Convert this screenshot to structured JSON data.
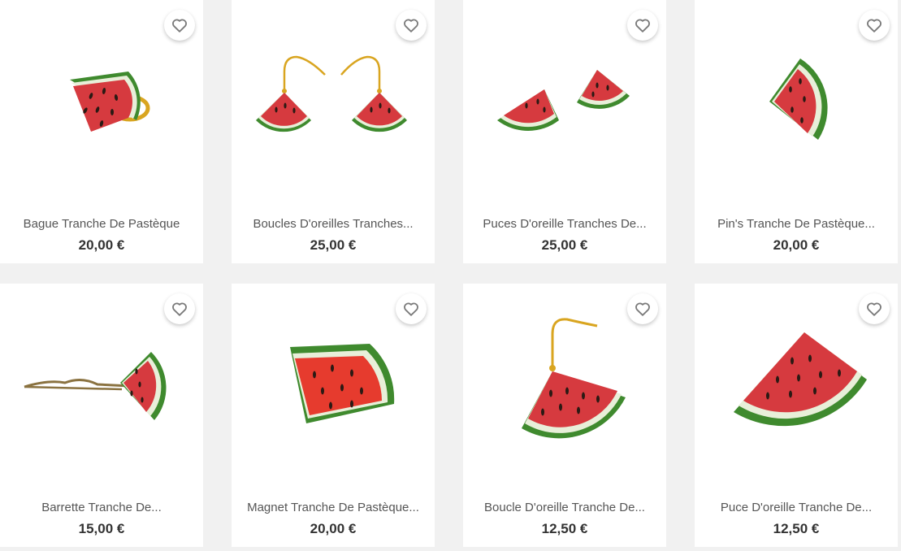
{
  "products": [
    {
      "title": "Bague Tranche De Pastèque",
      "price": "20,00 €",
      "kind": "ring"
    },
    {
      "title": "Boucles D'oreilles Tranches...",
      "price": "25,00 €",
      "kind": "earrings-pair"
    },
    {
      "title": "Puces D'oreille Tranches De...",
      "price": "25,00 €",
      "kind": "studs-pair"
    },
    {
      "title": "Pin's Tranche De Pastèque...",
      "price": "20,00 €",
      "kind": "pin"
    },
    {
      "title": "Barrette Tranche De...",
      "price": "15,00 €",
      "kind": "hairpin"
    },
    {
      "title": "Magnet Tranche De Pastèque...",
      "price": "20,00 €",
      "kind": "magnet"
    },
    {
      "title": "Boucle D'oreille Tranche De...",
      "price": "12,50 €",
      "kind": "earring-single"
    },
    {
      "title": "Puce D'oreille Tranche De...",
      "price": "12,50 €",
      "kind": "stud-single"
    }
  ],
  "colors": {
    "flesh": "#d63a3f",
    "rind": "#3f8a2e",
    "rind_inner": "#e8efd9",
    "seed": "#2b1a14",
    "gold": "#d9a520",
    "bronze": "#8a7240",
    "page_bg": "#f1f1f1"
  },
  "icons": {
    "wishlist": "heart-outline-icon"
  }
}
